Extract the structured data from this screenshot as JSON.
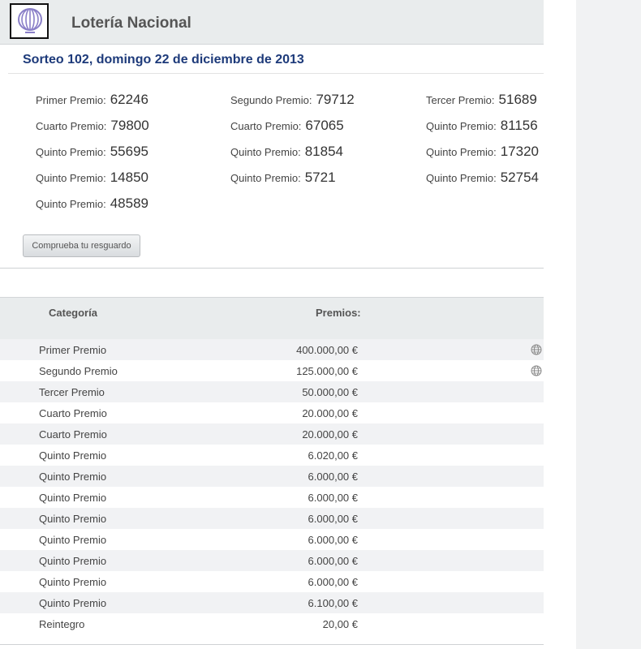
{
  "header": {
    "title": "Lotería Nacional"
  },
  "draw": {
    "title": "Sorteo 102, domingo 22 de diciembre de 2013"
  },
  "prizes": [
    {
      "label": "Primer Premio:",
      "number": "62246"
    },
    {
      "label": "Segundo Premio:",
      "number": "79712"
    },
    {
      "label": "Tercer Premio:",
      "number": "51689"
    },
    {
      "label": "Cuarto Premio:",
      "number": "79800"
    },
    {
      "label": "Cuarto Premio:",
      "number": "67065"
    },
    {
      "label": "Quinto Premio:",
      "number": "81156"
    },
    {
      "label": "Quinto Premio:",
      "number": "55695"
    },
    {
      "label": "Quinto Premio:",
      "number": "81854"
    },
    {
      "label": "Quinto Premio:",
      "number": "17320"
    },
    {
      "label": "Quinto Premio:",
      "number": "14850"
    },
    {
      "label": "Quinto Premio:",
      "number": "5721"
    },
    {
      "label": "Quinto Premio:",
      "number": "52754"
    },
    {
      "label": "Quinto Premio:",
      "number": "48589"
    }
  ],
  "check_button": {
    "label": "Comprueba tu resguardo"
  },
  "table": {
    "headers": {
      "category": "Categoría",
      "prizes": "Premios:"
    },
    "rows": [
      {
        "category": "Primer Premio",
        "amount": "400.000,00 €",
        "icon": "globe-icon"
      },
      {
        "category": "Segundo Premio",
        "amount": "125.000,00 €",
        "icon": "globe-icon"
      },
      {
        "category": "Tercer Premio",
        "amount": "50.000,00 €"
      },
      {
        "category": "Cuarto Premio",
        "amount": "20.000,00 €"
      },
      {
        "category": "Cuarto Premio",
        "amount": "20.000,00 €"
      },
      {
        "category": "Quinto Premio",
        "amount": "6.020,00 €"
      },
      {
        "category": "Quinto Premio",
        "amount": "6.000,00 €"
      },
      {
        "category": "Quinto Premio",
        "amount": "6.000,00 €"
      },
      {
        "category": "Quinto Premio",
        "amount": "6.000,00 €"
      },
      {
        "category": "Quinto Premio",
        "amount": "6.000,00 €"
      },
      {
        "category": "Quinto Premio",
        "amount": "6.000,00 €"
      },
      {
        "category": "Quinto Premio",
        "amount": "6.000,00 €"
      },
      {
        "category": "Quinto Premio",
        "amount": "6.100,00 €"
      },
      {
        "category": "Reintegro",
        "amount": "20,00 €"
      }
    ]
  },
  "colors": {
    "accent": "#1d3a7a",
    "header_bg": "#e9eced",
    "row_alt": "#f1f2f4",
    "logo_purple": "#8a7fc8"
  }
}
